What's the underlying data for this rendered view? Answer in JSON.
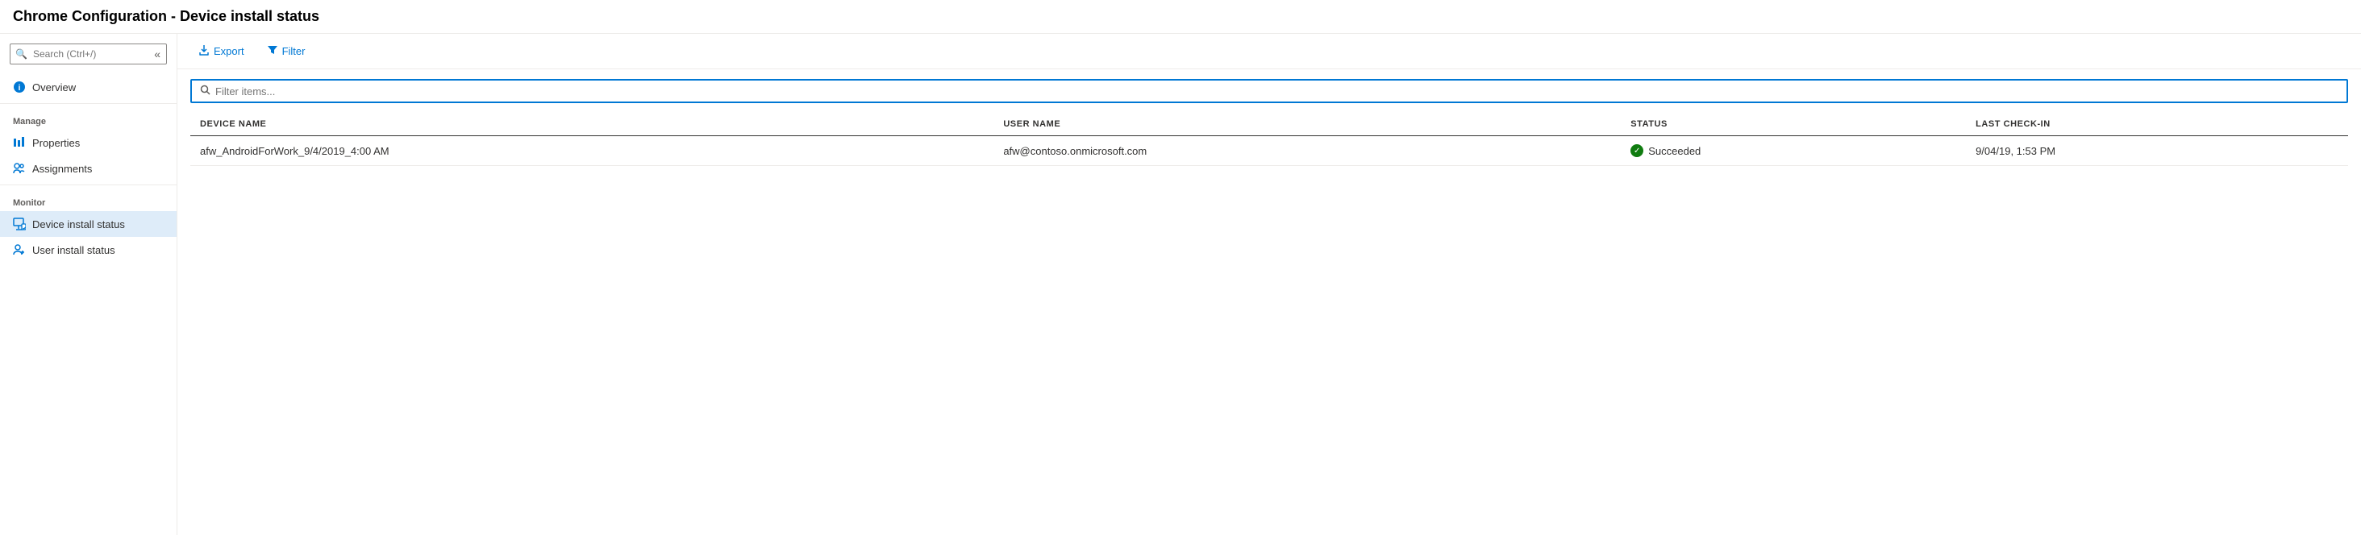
{
  "title": "Chrome Configuration - Device install status",
  "sidebar": {
    "search_placeholder": "Search (Ctrl+/)",
    "sections": [
      {
        "label": null,
        "items": [
          {
            "id": "overview",
            "label": "Overview",
            "icon": "info-icon",
            "active": false
          }
        ]
      },
      {
        "label": "Manage",
        "items": [
          {
            "id": "properties",
            "label": "Properties",
            "icon": "properties-icon",
            "active": false
          },
          {
            "id": "assignments",
            "label": "Assignments",
            "icon": "assignments-icon",
            "active": false
          }
        ]
      },
      {
        "label": "Monitor",
        "items": [
          {
            "id": "device-install-status",
            "label": "Device install status",
            "icon": "device-install-icon",
            "active": true
          },
          {
            "id": "user-install-status",
            "label": "User install status",
            "icon": "user-install-icon",
            "active": false
          }
        ]
      }
    ]
  },
  "toolbar": {
    "export_label": "Export",
    "filter_label": "Filter"
  },
  "table": {
    "filter_placeholder": "Filter items...",
    "columns": [
      {
        "id": "device-name",
        "label": "DEVICE NAME"
      },
      {
        "id": "user-name",
        "label": "USER NAME"
      },
      {
        "id": "status",
        "label": "STATUS"
      },
      {
        "id": "last-checkin",
        "label": "LAST CHECK-IN"
      }
    ],
    "rows": [
      {
        "device_name": "afw_AndroidForWork_9/4/2019_4:00 AM",
        "user_name": "afw@contoso.onmicrosoft.com",
        "status": "Succeeded",
        "status_type": "success",
        "last_checkin": "9/04/19, 1:53 PM"
      }
    ]
  }
}
